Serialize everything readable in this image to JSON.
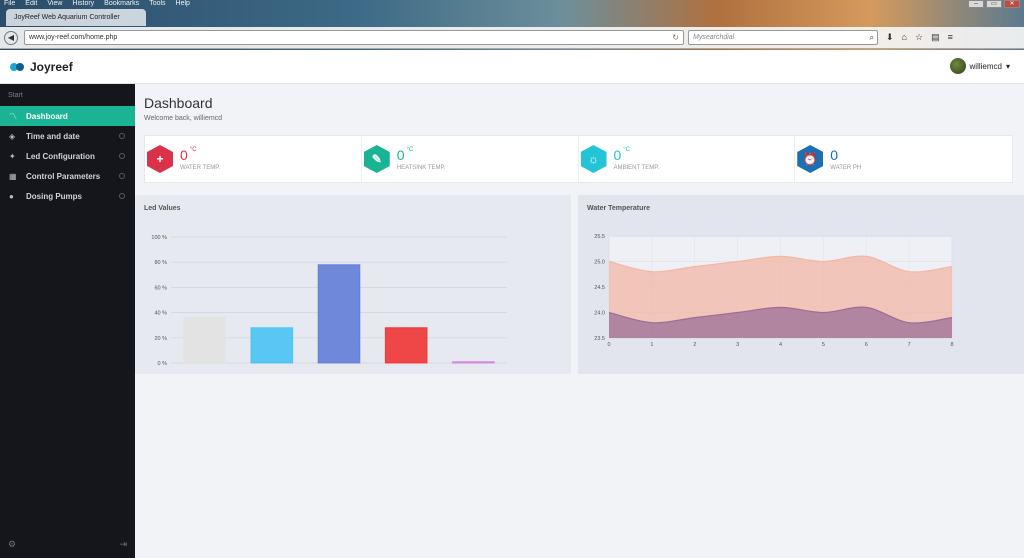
{
  "browser": {
    "menu": [
      "File",
      "Edit",
      "View",
      "History",
      "Bookmarks",
      "Tools",
      "Help"
    ],
    "tab_title": "JoyReef Web Aquarium Controller",
    "url": "www.joy-reef.com/home.php",
    "search_placeholder": "Mysearchdial",
    "window_buttons": [
      "–",
      "▭",
      "✕"
    ]
  },
  "header": {
    "app_name": "Joyreef",
    "username": "williemcd"
  },
  "sidebar": {
    "section_label": "Start",
    "items": [
      {
        "label": "Dashboard",
        "icon": "chart-line-icon",
        "glyph": "〽",
        "active": true
      },
      {
        "label": "Time and date",
        "icon": "layers-icon",
        "glyph": "◈",
        "active": false
      },
      {
        "label": "Led Configuration",
        "icon": "lightbulb-icon",
        "glyph": "✦",
        "active": false
      },
      {
        "label": "Control Parameters",
        "icon": "grid-icon",
        "glyph": "▦",
        "active": false
      },
      {
        "label": "Dosing Pumps",
        "icon": "drop-icon",
        "glyph": "●",
        "active": false
      }
    ]
  },
  "dashboard": {
    "title": "Dashboard",
    "welcome": "Welcome back, williemcd",
    "stats": [
      {
        "value": "0",
        "unit": "°C",
        "caption": "WATER TEMP.",
        "color": "#d9334a",
        "icon": "plus-icon",
        "glyph": "+"
      },
      {
        "value": "0",
        "unit": "°C",
        "caption": "HEATSINK TEMP.",
        "color": "#1ab394",
        "icon": "lightbulb-icon",
        "glyph": "✎"
      },
      {
        "value": "0",
        "unit": "°C",
        "caption": "AMBIENT TEMP.",
        "color": "#22c4d6",
        "icon": "sun-icon",
        "glyph": "☼"
      },
      {
        "value": "0",
        "unit": "",
        "caption": "WATER PH",
        "color": "#1b6fb3",
        "icon": "alarm-clock-icon",
        "glyph": "⏰"
      }
    ]
  },
  "chart_data": [
    {
      "type": "bar",
      "title": "Led Values",
      "categories": [
        "",
        "",
        "",
        "",
        ""
      ],
      "values": [
        36,
        28,
        78,
        28,
        1
      ],
      "colors": [
        "#e2e2e2",
        "#3fc1f5",
        "#5a77d6",
        "#f02a2a",
        "#d77be0"
      ],
      "ylim": [
        0,
        100
      ],
      "yticks": [
        "0 %",
        "20 %",
        "40 %",
        "60 %",
        "80 %",
        "100 %"
      ],
      "grid": true
    },
    {
      "type": "area",
      "title": "Water Temperature",
      "x": [
        0,
        1,
        2,
        3,
        4,
        5,
        6,
        7,
        8
      ],
      "series": [
        {
          "values": [
            25.0,
            24.8,
            24.9,
            25.0,
            25.1,
            25.0,
            25.1,
            24.8,
            24.9
          ],
          "color": "#f2b7a4"
        },
        {
          "values": [
            24.0,
            23.8,
            23.9,
            24.0,
            24.1,
            24.0,
            24.1,
            23.8,
            23.9
          ],
          "color": "#9b6e98"
        }
      ],
      "ylim": [
        23.5,
        25.5
      ],
      "yticks": [
        "23.5",
        "24.0",
        "24.5",
        "25.0",
        "25.5"
      ],
      "xticks": [
        "0",
        "1",
        "2",
        "3",
        "4",
        "5",
        "6",
        "7",
        "8"
      ],
      "grid": true
    }
  ]
}
